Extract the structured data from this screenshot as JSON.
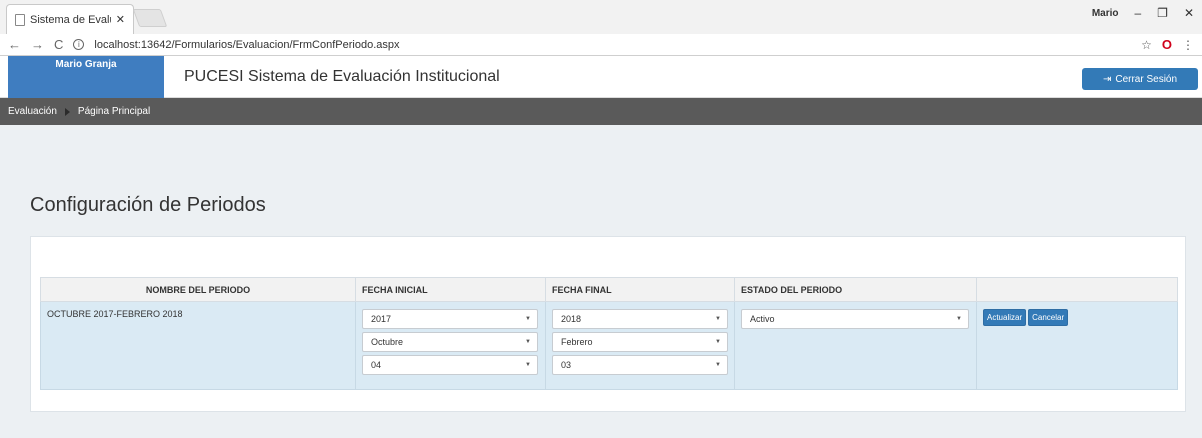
{
  "browser": {
    "tab_title": "Sistema de Evaluación In",
    "url": "localhost:13642/Formularios/Evaluacion/FrmConfPeriodo.aspx",
    "profile": "Mario"
  },
  "header": {
    "user_name": "Mario Granja",
    "app_title": "PUCESI Sistema de Evaluación Institucional",
    "logout_label": "Cerrar Sesión"
  },
  "nav": {
    "item1": "Evaluación",
    "item2": "Página Principal"
  },
  "page": {
    "title": "Configuración de Periodos"
  },
  "table": {
    "headers": [
      "NOMBRE DEL PERIODO",
      "FECHA INICIAL",
      "FECHA FINAL",
      "ESTADO DEL PERIODO",
      ""
    ],
    "row": {
      "name": "OCTUBRE 2017-FEBRERO 2018",
      "start": {
        "year": "2017",
        "month": "Octubre",
        "day": "04"
      },
      "end": {
        "year": "2018",
        "month": "Febrero",
        "day": "03"
      },
      "state": "Activo",
      "update_label": "Actualizar",
      "cancel_label": "Cancelar"
    }
  },
  "colors": {
    "user_box": "#3f7dc0",
    "primary": "#337ab7",
    "navbar": "#5a5a5a",
    "row_bg": "#daeaf4",
    "page_bg": "#ecf0f3"
  }
}
